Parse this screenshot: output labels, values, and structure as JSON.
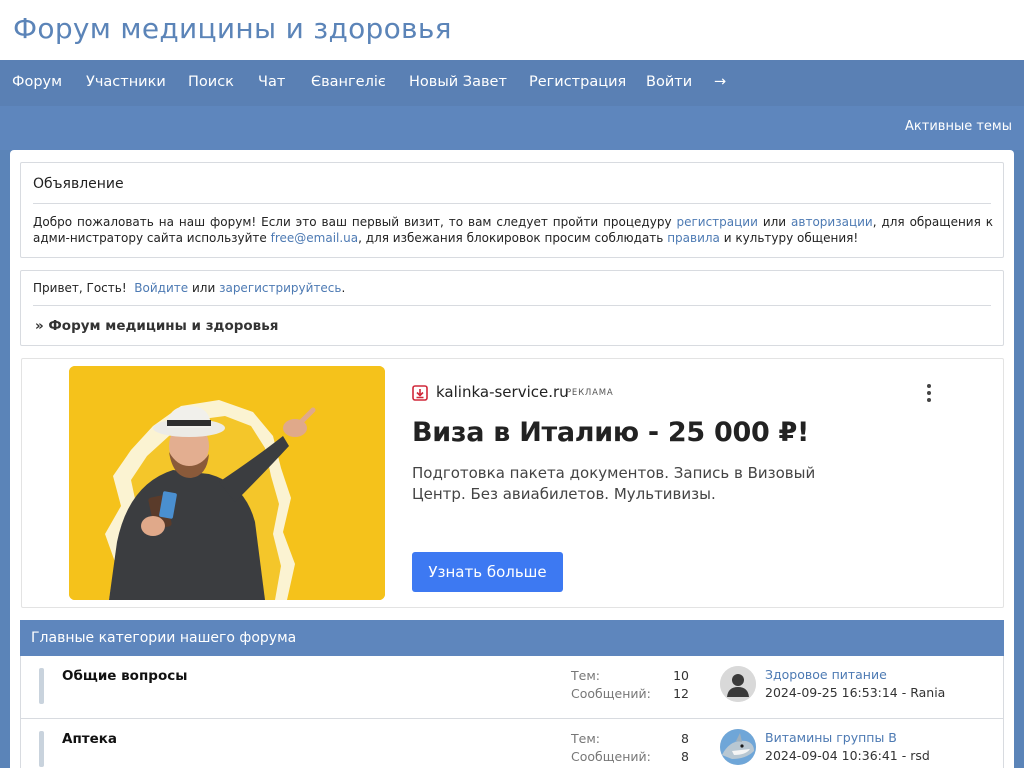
{
  "header": {
    "site_title": "Форум медицины и здоровья"
  },
  "nav": {
    "items": [
      {
        "label": "Форум"
      },
      {
        "label": "Участники"
      },
      {
        "label": "Поиск"
      },
      {
        "label": "Чат"
      },
      {
        "label": "Євангеліє"
      },
      {
        "label": "Новый Завет"
      },
      {
        "label": "Регистрация"
      },
      {
        "label": "Войти"
      },
      {
        "label": "→"
      }
    ]
  },
  "subbar": {
    "active_topics": "Активные темы"
  },
  "announcement": {
    "title": "Объявление",
    "t1": "Добро пожаловать на наш форум! Если это ваш первый визит, то вам следует пройти процедуру ",
    "l1": "регистрации",
    "t2": " или ",
    "l2": "авторизации",
    "t3": ", для обращения к адми-нистратору сайта используйте ",
    "l3": "free@email.ua",
    "t4": ", для избежания блокировок просим соблюдать ",
    "l4": "правила",
    "t5": " и культуру общения!"
  },
  "welcome": {
    "greeting": "Привет, Гость!",
    "login_link": "Войдите",
    "or": "или",
    "register_link": "зарегистрируйтесь",
    "period": ".",
    "breadcrumb": "» Форум медицины и здоровья"
  },
  "ad": {
    "domain": "kalinka-service.ru",
    "tag": "РЕКЛАМА",
    "headline": "Виза в Италию - 25 000 ₽!",
    "description": "Подготовка пакета документов. Запись в Визовый Центр. Без авиабилетов. Мультивизы.",
    "cta": "Узнать больше",
    "accent_color": "#3d79f2",
    "image_bg": "#f5c21b"
  },
  "categories": {
    "header": "Главные категории нашего форума",
    "topics_label": "Тем:",
    "posts_label": "Сообщений:",
    "rows": [
      {
        "name": "Общие вопросы",
        "topics": "10",
        "posts": "12",
        "last_topic": "Здоровое питание",
        "last_meta": "2024-09-25 16:53:14 - Rania",
        "avatar_icon": "default-user-avatar-icon"
      },
      {
        "name": "Аптека",
        "topics": "8",
        "posts": "8",
        "last_topic": "Витамины группы В",
        "last_meta": "2024-09-04 10:36:41 - rsd",
        "avatar_icon": "shark-avatar-icon"
      }
    ]
  },
  "colors": {
    "brand": "#5b84b8",
    "nav_bg": "#5a80b4",
    "link": "#4d7ab3"
  }
}
